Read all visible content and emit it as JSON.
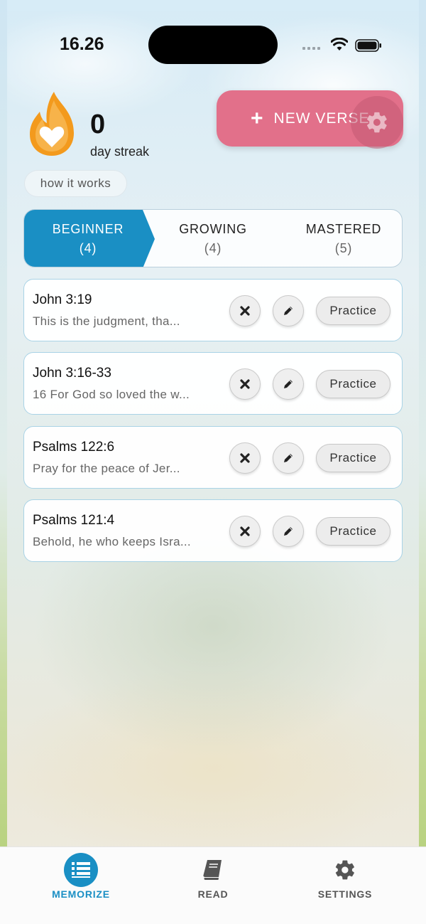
{
  "status_bar": {
    "time": "16.26"
  },
  "streak": {
    "count": "0",
    "label": "day streak",
    "how_it_works": "how it works"
  },
  "new_verse": {
    "label": "NEW VERSE"
  },
  "tabs": [
    {
      "label": "BEGINNER",
      "count": "(4)",
      "active": true
    },
    {
      "label": "GROWING",
      "count": "(4)",
      "active": false
    },
    {
      "label": "MASTERED",
      "count": "(5)",
      "active": false
    }
  ],
  "verses": [
    {
      "reference": "John 3:19",
      "preview": "This is the judgment, tha...",
      "practice_label": "Practice"
    },
    {
      "reference": "John 3:16-33",
      "preview": "16 For God so loved the w...",
      "practice_label": "Practice"
    },
    {
      "reference": "Psalms 122:6",
      "preview": "Pray for the peace of Jer...",
      "practice_label": "Practice"
    },
    {
      "reference": "Psalms 121:4",
      "preview": "Behold, he who keeps Isra...",
      "practice_label": "Practice"
    }
  ],
  "nav": {
    "memorize": "MEMORIZE",
    "read": "READ",
    "settings": "SETTINGS"
  },
  "colors": {
    "accent": "#1a8fc4",
    "new_verse": "#e2708a",
    "flame": "#f39a1d"
  }
}
